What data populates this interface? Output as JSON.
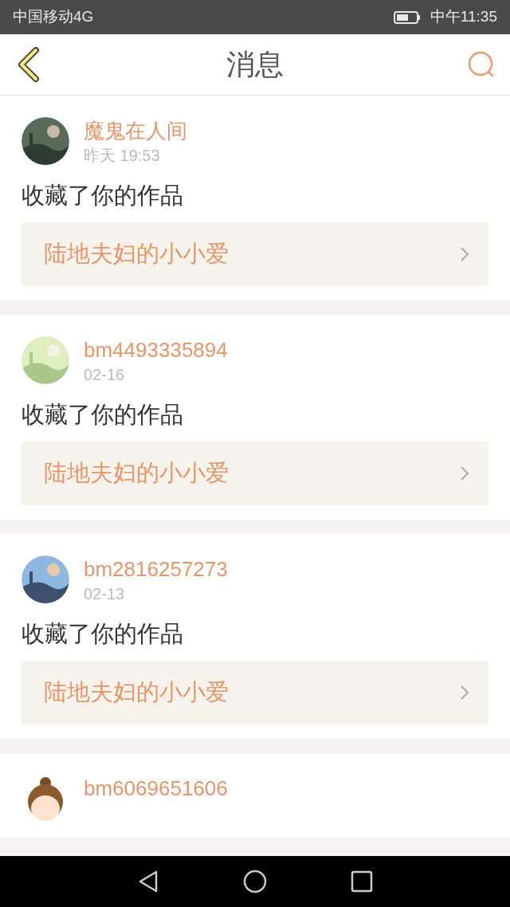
{
  "status_bar": {
    "carrier": "中国移动4G",
    "time": "中午11:35"
  },
  "header": {
    "title": "消息"
  },
  "messages": [
    {
      "name": "魔鬼在人间",
      "time": "昨天 19:53",
      "action": "收藏了你的作品",
      "work_title": "陆地夫妇的小小爱"
    },
    {
      "name": "bm4493335894",
      "time": "02-16",
      "action": "收藏了你的作品",
      "work_title": "陆地夫妇的小小爱"
    },
    {
      "name": "bm2816257273",
      "time": "02-13",
      "action": "收藏了你的作品",
      "work_title": "陆地夫妇的小小爱"
    },
    {
      "name": "bm6069651606",
      "avatar": {
        "kind": "cartoon"
      }
    }
  ]
}
